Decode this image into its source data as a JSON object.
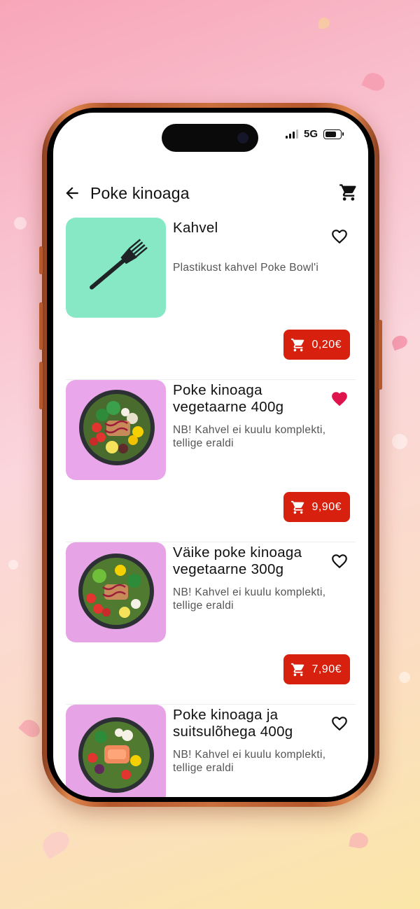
{
  "status_bar": {
    "network": "5G"
  },
  "app_bar": {
    "title": "Poke kinoaga",
    "back_icon": "arrow-left-icon",
    "cart_icon": "shopping-cart-icon"
  },
  "colors": {
    "accent": "#d8200e",
    "favorite": "#e0144c"
  },
  "products": [
    {
      "name": "Kahvel",
      "description": "Plastikust kahvel Poke Bowl'i",
      "price": "0,20€",
      "favorite": false,
      "image": "fork"
    },
    {
      "name": "Poke kinoaga vegetaarne 400g",
      "description": "NB! Kahvel ei kuulu komplekti, tellige eraldi",
      "price": "9,90€",
      "favorite": true,
      "image": "bowl"
    },
    {
      "name": "Väike poke kinoaga vegetaarne 300g",
      "description": "NB! Kahvel ei kuulu komplekti, tellige eraldi",
      "price": "7,90€",
      "favorite": false,
      "image": "bowl"
    },
    {
      "name": "Poke kinoaga ja suitsulõhega 400g",
      "description": "NB! Kahvel ei kuulu komplekti, tellige eraldi",
      "price": "",
      "favorite": false,
      "image": "bowl"
    }
  ]
}
